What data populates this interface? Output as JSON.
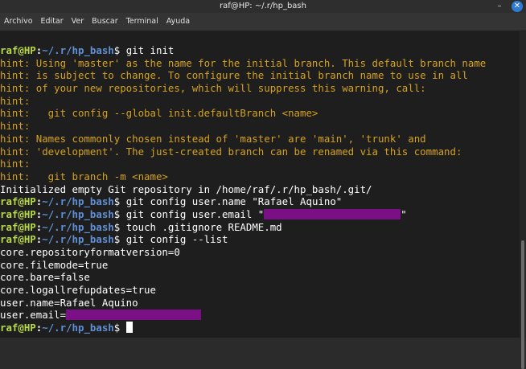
{
  "window": {
    "title": "raf@HP: ~/.r/hp_bash",
    "minimize_glyph": "–",
    "close_glyph": "✕"
  },
  "menu": [
    "Archivo",
    "Editar",
    "Ver",
    "Buscar",
    "Terminal",
    "Ayuda"
  ],
  "prompt": {
    "user": "raf@HP",
    "sep": ":",
    "path": "~/.r/hp_bash",
    "dollar": "$ "
  },
  "lines": {
    "cmd1": "git init",
    "hint1": "hint: Using 'master' as the name for the initial branch. This default branch name",
    "hint2": "hint: is subject to change. To configure the initial branch name to use in all",
    "hint3": "hint: of your new repositories, which will suppress this warning, call:",
    "hint4": "hint:",
    "hint5": "hint:   git config --global init.defaultBranch <name>",
    "hint6": "hint:",
    "hint7": "hint: Names commonly chosen instead of 'master' are 'main', 'trunk' and",
    "hint8": "hint: 'development'. The just-created branch can be renamed via this command:",
    "hint9": "hint:",
    "hint10": "hint:   git branch -m <name>",
    "init_out": "Initialized empty Git repository in /home/raf/.r/hp_bash/.git/",
    "cmd2": "git config user.name \"Rafael Aquino\"",
    "cmd3_start": "git config user.email \"",
    "cmd3_end": "\"",
    "cmd4": "touch .gitignore README.md",
    "cmd5": "git config --list",
    "out1": "core.repositoryformatversion=0",
    "out2": "core.filemode=true",
    "out3": "core.bare=false",
    "out4": "core.logallrefupdates=true",
    "out5": "user.name=Rafael Aquino",
    "out6": "user.email="
  },
  "colors": {
    "terminal_bg": "#1e1e1e",
    "prompt_user": "#b8d94a",
    "prompt_path": "#5f8fd4",
    "hint_text": "#d4a21e",
    "redaction": "#7b0f86"
  }
}
